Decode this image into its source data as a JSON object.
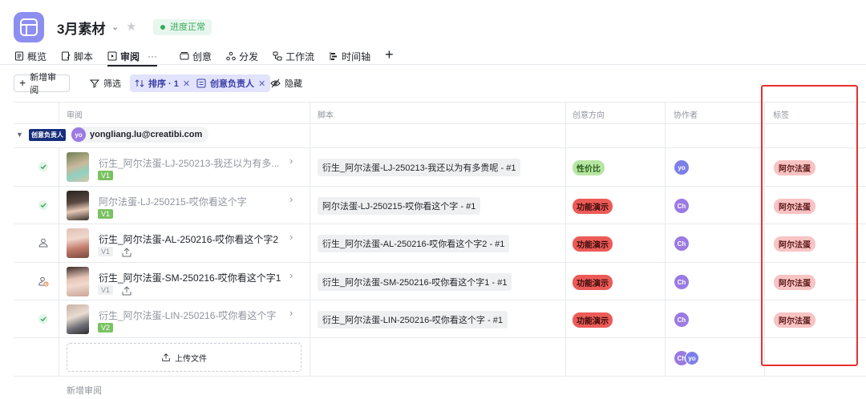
{
  "header": {
    "title": "3月素材",
    "status": "进度正常",
    "accent": "#8c8ff0"
  },
  "tabs": [
    {
      "label": "概览",
      "icon": "doc-list-icon"
    },
    {
      "label": "脚本",
      "icon": "script-icon"
    },
    {
      "label": "审阅",
      "icon": "review-icon",
      "active": true,
      "more": "···"
    },
    {
      "label": "创意",
      "icon": "creative-icon"
    },
    {
      "label": "分发",
      "icon": "distribute-icon"
    },
    {
      "label": "工作流",
      "icon": "workflow-icon"
    },
    {
      "label": "时间轴",
      "icon": "timeline-icon"
    }
  ],
  "toolbar": {
    "new_label": "新增审阅",
    "filter_label": "筛选",
    "sort_label": "排序 · 1",
    "owner_label": "创意负责人",
    "hide_label": "隐藏"
  },
  "columns": {
    "review": "审阅",
    "script": "脚本",
    "direction": "创意方向",
    "collaborator": "协作者",
    "tag": "标签"
  },
  "group": {
    "tag": "创意负责人",
    "avatar": "yo",
    "email": "yongliang.lu@creatibi.com"
  },
  "rows": [
    {
      "status": "approved",
      "title": "衍生_阿尔法蛋-LJ-250213-我还以为有多...",
      "version": "V1",
      "version_style": "green",
      "script": "衍生_阿尔法蛋-LJ-250213-我还以为有多贵呢 - #1",
      "direction": "性价比",
      "direction_style": "green",
      "collaborator": "yo",
      "tag": "阿尔法蛋"
    },
    {
      "status": "approved",
      "title": "阿尔法蛋-LJ-250215-哎你看这个字",
      "version": "V1",
      "version_style": "green",
      "script": "阿尔法蛋-LJ-250215-哎你看这个字 - #1",
      "direction": "功能演示",
      "direction_style": "red",
      "collaborator": "Ch",
      "tag": "阿尔法蛋"
    },
    {
      "status": "assignee",
      "title": "衍生_阿尔法蛋-AL-250216-哎你看这个字2",
      "version": "V1",
      "version_style": "gray",
      "script": "衍生_阿尔法蛋-AL-250216-哎你看这个字2 - #1",
      "direction": "功能演示",
      "direction_style": "red",
      "collaborator": "Ch",
      "tag": "阿尔法蛋"
    },
    {
      "status": "assignee-pending",
      "title": "衍生_阿尔法蛋-SM-250216-哎你看这个字1",
      "version": "V1",
      "version_style": "gray",
      "script": "衍生_阿尔法蛋-SM-250216-哎你看这个字1 - #1",
      "direction": "功能演示",
      "direction_style": "red",
      "collaborator": "Ch",
      "tag": "阿尔法蛋"
    },
    {
      "status": "approved",
      "title": "衍生_阿尔法蛋-LIN-250216-哎你看这个字",
      "version": "V2",
      "version_style": "green",
      "script": "衍生_阿尔法蛋-LIN-250216-哎你看这个字 - #1",
      "direction": "功能演示",
      "direction_style": "red",
      "collaborator": "Ch",
      "tag": "阿尔法蛋"
    }
  ],
  "upload_label": "上传文件",
  "footer_collaborators": [
    "Ch",
    "yo"
  ],
  "new_review_label": "新增审阅"
}
